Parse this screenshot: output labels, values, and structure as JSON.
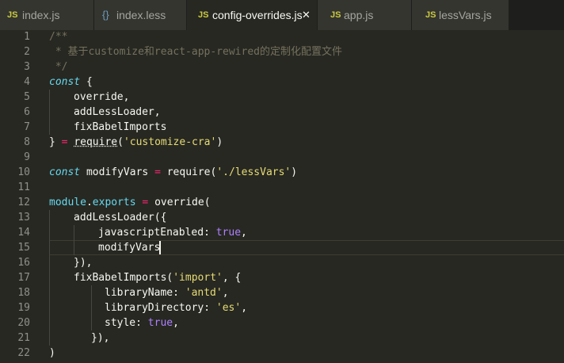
{
  "tabs": [
    {
      "icon": "JS",
      "label": "index.js",
      "active": false
    },
    {
      "icon": "{}",
      "label": "index.less",
      "active": false
    },
    {
      "icon": "JS",
      "label": "config-overrides.js",
      "active": true,
      "close": "✕"
    },
    {
      "icon": "JS",
      "label": "app.js",
      "active": false
    },
    {
      "icon": "JS",
      "label": "lessVars.js",
      "active": false
    }
  ],
  "line_numbers": [
    "1",
    "2",
    "3",
    "4",
    "5",
    "6",
    "7",
    "8",
    "9",
    "10",
    "11",
    "12",
    "13",
    "14",
    "15",
    "16",
    "17",
    "18",
    "19",
    "20",
    "21",
    "22"
  ],
  "code": {
    "l1": {
      "t": "/**"
    },
    "l2": {
      "t": " * 基于customize和react-app-rewired的定制化配置文件"
    },
    "l3": {
      "t": " */"
    },
    "l4": {
      "kw": "const",
      "rest": " {"
    },
    "l5": {
      "id": "override",
      "rest": ","
    },
    "l6": {
      "id": "addLessLoader",
      "rest": ","
    },
    "l7": {
      "id": "fixBabelImports"
    },
    "l8": {
      "pre": "} ",
      "op": "=",
      "sp": " ",
      "fn": "require",
      "op2": "(",
      "str": "'customize-cra'",
      "close": ")"
    },
    "l10": {
      "kw": "const",
      "id": " modifyVars ",
      "op": "=",
      "sp": " ",
      "fn": "require",
      "op2": "(",
      "str": "'./lessVars'",
      "close": ")"
    },
    "l12": {
      "mod": "module",
      "dot": ".",
      "prop": "exports",
      "sp": " ",
      "op": "=",
      "sp2": " ",
      "fn": "override",
      "close": "("
    },
    "l13": {
      "fn": "addLessLoader",
      "close": "({"
    },
    "l14": {
      "key": "javascriptEnabled",
      "colon": ": ",
      "val": "true",
      "rest": ","
    },
    "l15": {
      "id": "modifyVars"
    },
    "l16": {
      "t": "}),"
    },
    "l17": {
      "fn": "fixBabelImports",
      "open": "(",
      "str": "'import'",
      "rest": ", {"
    },
    "l18": {
      "key": "libraryName",
      "colon": ": ",
      "str": "'antd'",
      "rest": ","
    },
    "l19": {
      "key": "libraryDirectory",
      "colon": ": ",
      "str": "'es'",
      "rest": ","
    },
    "l20": {
      "key": "style",
      "colon": ": ",
      "val": "true",
      "rest": ","
    },
    "l21": {
      "t": "}),"
    },
    "l22": {
      "t": ")"
    }
  },
  "colors": {
    "background": "#272822",
    "tab_bar": "#1e1f1c",
    "comment": "#75715e",
    "keyword": "#66d9ef",
    "string": "#e6db74",
    "function": "#a6e22e",
    "number_boolean": "#ae81ff",
    "operator": "#f92672"
  }
}
